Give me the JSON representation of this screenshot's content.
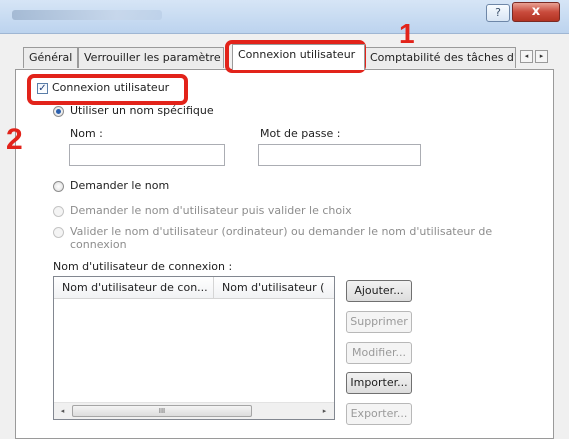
{
  "window": {
    "help_label": "?",
    "close_label": "x"
  },
  "tabs": [
    {
      "label": "Général"
    },
    {
      "label": "Verrouiller les paramètre"
    },
    {
      "label": "Connexion utilisateur"
    },
    {
      "label": "Comptabilité des tâches d'i"
    }
  ],
  "tab_scroll": {
    "left": "◂",
    "right": "▸"
  },
  "login": {
    "checkbox_label": "Connexion utilisateur",
    "checked": true,
    "specific_name_label": "Utiliser un nom spécifique",
    "name_label": "Nom :",
    "name_value": "",
    "password_label": "Mot de passe :",
    "password_value": "",
    "ask_name_label": "Demander le nom",
    "ask_validate_label": "Demander le nom d'utilisateur puis valider le choix",
    "validate_line1": "Valider le nom d'utilisateur (ordinateur) ou demander le nom d'utilisateur de",
    "validate_line2": "connexion"
  },
  "login_list": {
    "title": "Nom d'utilisateur de connexion :",
    "columns": [
      "Nom d'utilisateur de con...",
      "Nom d'utilisateur ("
    ],
    "rows": [],
    "scroll_left": "◂",
    "scroll_right": "▸",
    "thumb_grip": "III"
  },
  "buttons": {
    "add": "Ajouter...",
    "delete": "Supprimer",
    "modify": "Modifier...",
    "import": "Importer...",
    "export": "Exporter..."
  },
  "callouts": {
    "step1": "1",
    "step2": "2",
    "color": "#e2231a"
  }
}
